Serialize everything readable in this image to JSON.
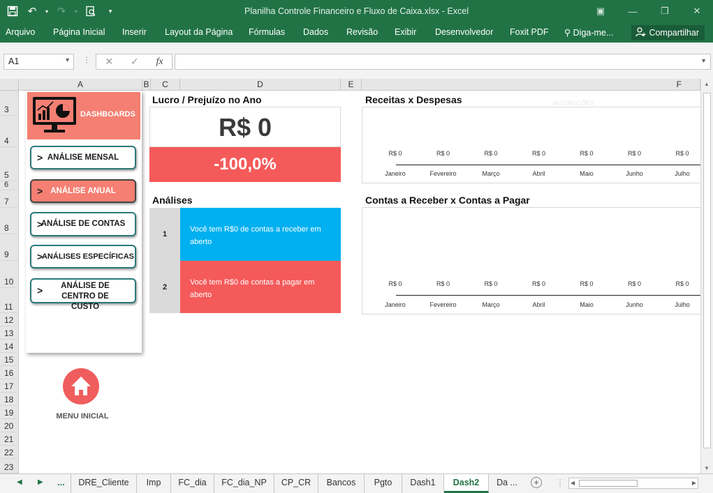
{
  "window": {
    "title": "Planilha Controle Financeiro e Fluxo de Caixa.xlsx - Excel"
  },
  "ribbon": {
    "tabs": [
      "Arquivo",
      "Página Inicial",
      "Inserir",
      "Layout da Página",
      "Fórmulas",
      "Dados",
      "Revisão",
      "Exibir",
      "Desenvolvedor",
      "Foxit PDF",
      "Diga-me..."
    ],
    "share_label": "Compartilhar"
  },
  "formula_bar": {
    "name_box": "A1",
    "fx_label": "fx",
    "value": ""
  },
  "columns": [
    "A",
    "B",
    "C",
    "D",
    "E",
    "F"
  ],
  "rows": [
    "3",
    "4",
    "5",
    "6",
    "7",
    "8",
    "9",
    "10",
    "11",
    "12",
    "13",
    "14",
    "15",
    "16",
    "17",
    "18",
    "19",
    "20",
    "21",
    "22",
    "23"
  ],
  "nav": {
    "header": "DASHBOARDS",
    "buttons": [
      "ANÁLISE MENSAL",
      "ANÁLISE ANUAL",
      "ANÁLISE DE CONTAS",
      "ANÁLISES ESPECÍFICAS",
      "ANÁLISE DE CENTRO DE CUSTO"
    ],
    "chevron": ">",
    "active_index": 1,
    "home_label": "MENU INICIAL"
  },
  "profit": {
    "heading": "Lucro / Prejuízo no Ano",
    "value": "R$ 0",
    "percent": "-100,0%"
  },
  "analyses": {
    "heading": "Análises",
    "items": [
      {
        "num": "1",
        "text": "Você tem R$0 de contas a receber em aberto",
        "color": "#00b0f0"
      },
      {
        "num": "2",
        "text": "Você tem R$0 de contas a pagar em aberto",
        "color": "#f55a5a"
      }
    ]
  },
  "watermark": "INSTRUÇÕES",
  "chart_data": [
    {
      "type": "bar",
      "title": "Receitas x Despesas",
      "categories": [
        "Janeiro",
        "Fevereiro",
        "Março",
        "Abril",
        "Maio",
        "Junho",
        "Julho"
      ],
      "data_labels": [
        "R$ 0",
        "R$ 0",
        "R$ 0",
        "R$ 0",
        "R$ 0",
        "R$ 0",
        "R$ 0"
      ],
      "values": [
        0,
        0,
        0,
        0,
        0,
        0,
        0
      ]
    },
    {
      "type": "bar",
      "title": "Contas a Receber x Contas a Pagar",
      "categories": [
        "Janeiro",
        "Fevereiro",
        "Março",
        "Abril",
        "Maio",
        "Junho",
        "Julho"
      ],
      "data_labels": [
        "R$ 0",
        "R$ 0",
        "R$ 0",
        "R$ 0",
        "R$ 0",
        "R$ 0",
        "R$ 0"
      ],
      "values": [
        0,
        0,
        0,
        0,
        0,
        0,
        0
      ]
    }
  ],
  "sheet_tabs": {
    "ellipsis": "...",
    "tabs": [
      "DRE_Cliente",
      "Imp",
      "FC_dia",
      "FC_dia_NP",
      "CP_CR",
      "Bancos",
      "Pgto",
      "Dash1",
      "Dash2",
      "Da ..."
    ],
    "active": "Dash2"
  },
  "colors": {
    "excel_green": "#217346",
    "salmon": "#f47f72",
    "red": "#f55a5a",
    "cyan": "#00b0f0",
    "teal_border": "#2a7a79"
  }
}
